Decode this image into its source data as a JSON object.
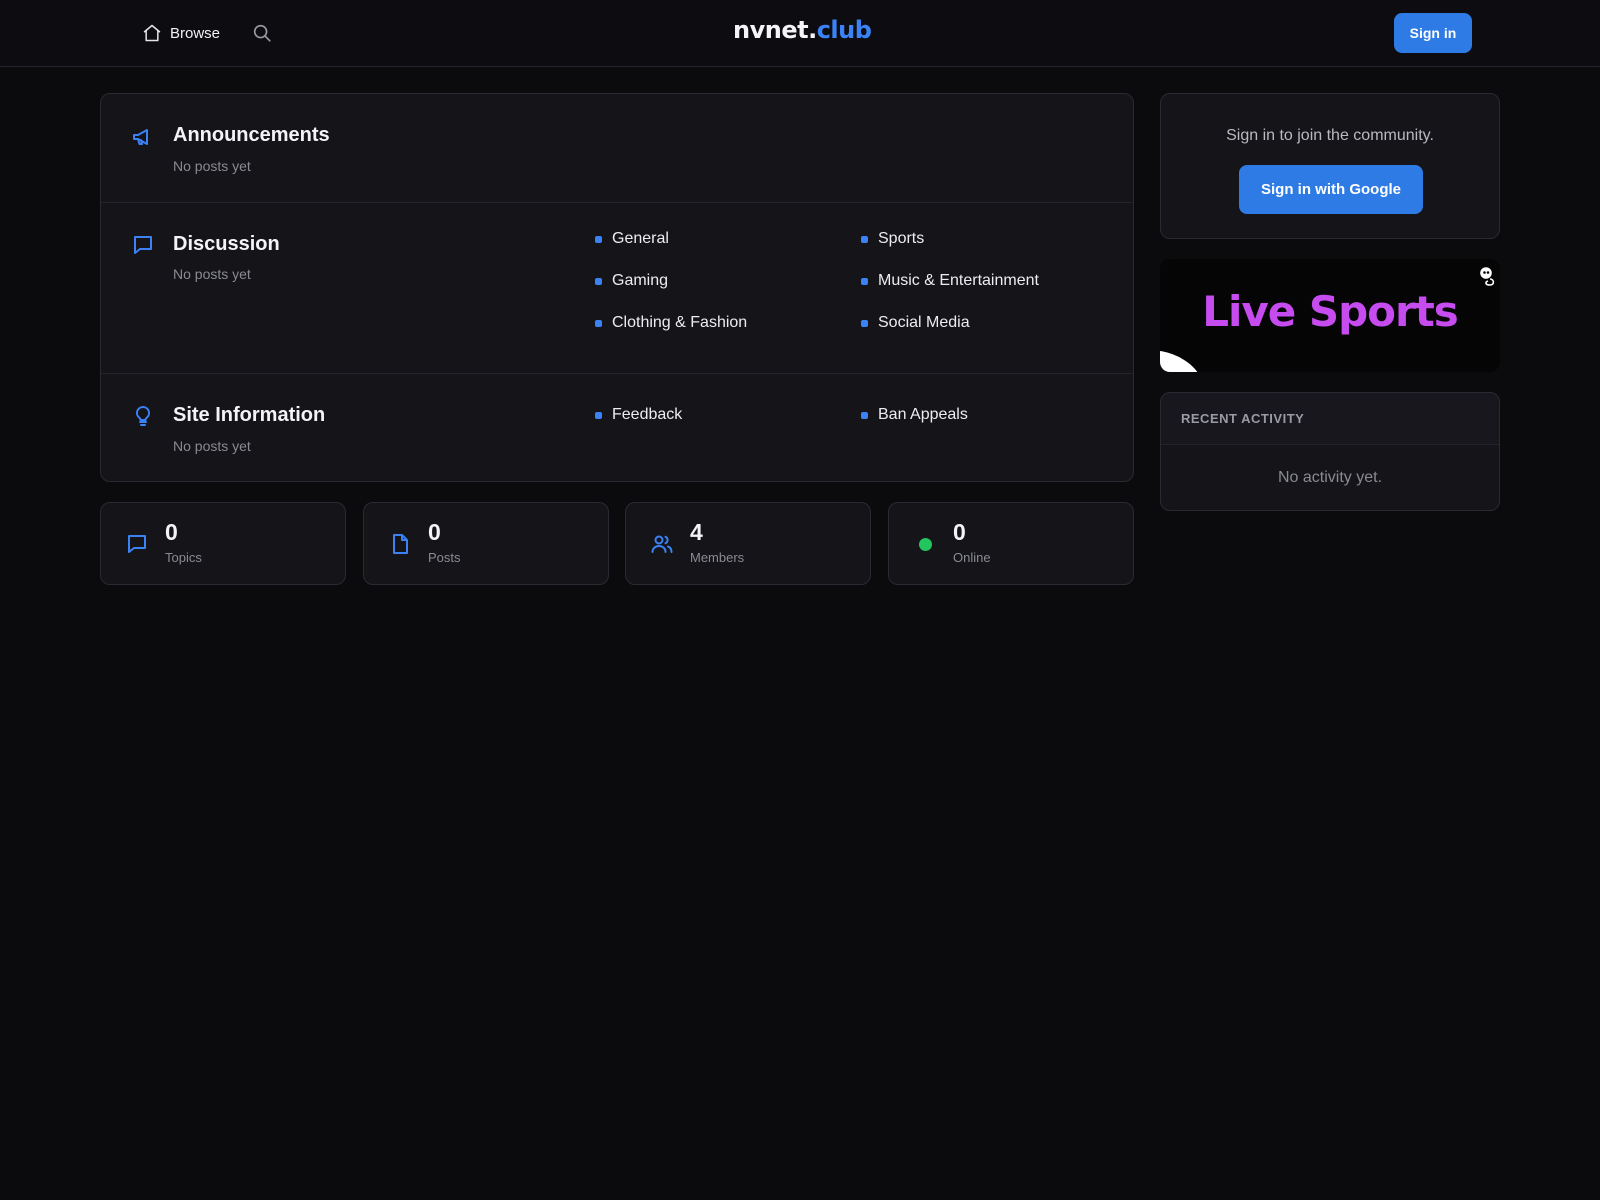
{
  "header": {
    "browse_label": "Browse",
    "logo_part1": "nvnet.",
    "logo_part2": "club",
    "signin_label": "Sign in"
  },
  "forum": {
    "sections": [
      {
        "title": "Announcements",
        "subtitle": "No posts yet",
        "icon": "megaphone-icon",
        "subforums": []
      },
      {
        "title": "Discussion",
        "subtitle": "No posts yet",
        "icon": "message-icon",
        "subforums": [
          "General",
          "Sports",
          "Gaming",
          "Music & Entertainment",
          "Clothing & Fashion",
          "Social Media"
        ]
      },
      {
        "title": "Site Information",
        "subtitle": "No posts yet",
        "icon": "lightbulb-icon",
        "subforums": [
          "Feedback",
          "Ban Appeals"
        ]
      }
    ]
  },
  "stats": [
    {
      "value": "0",
      "label": "Topics",
      "icon": "message-icon"
    },
    {
      "value": "0",
      "label": "Posts",
      "icon": "file-icon"
    },
    {
      "value": "4",
      "label": "Members",
      "icon": "users-icon"
    },
    {
      "value": "0",
      "label": "Online",
      "icon": "online-dot"
    }
  ],
  "sidebar": {
    "join_text": "Sign in to join the community.",
    "google_button": "Sign in with Google",
    "promo_text": "Live Sports",
    "activity_title": "RECENT ACTIVITY",
    "activity_empty": "No activity yet."
  },
  "colors": {
    "accent": "#3b82f6",
    "button": "#2f7be5",
    "promo": "#c64cf0",
    "online": "#22c55e",
    "background": "#0b0b0e",
    "card": "#141419"
  }
}
